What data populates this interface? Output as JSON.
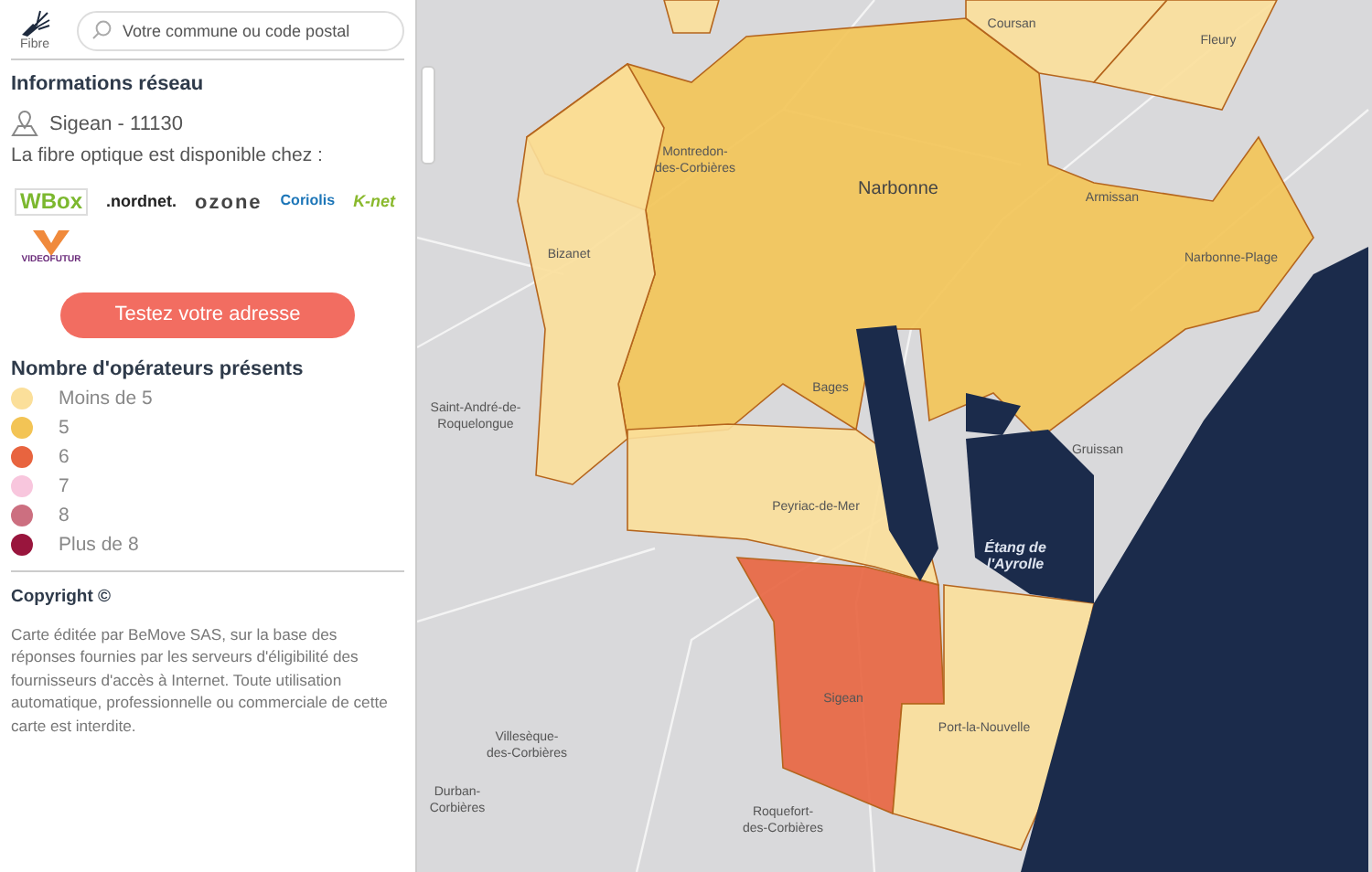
{
  "header": {
    "icon_label": "Fibre",
    "search": {
      "placeholder": "Votre commune ou code postal"
    }
  },
  "network_info": {
    "title": "Informations réseau",
    "location": "Sigean - 11130",
    "availability": "La fibre optique est disponible chez :",
    "providers": [
      {
        "kind": "wibox",
        "name": "WBox"
      },
      {
        "kind": "nordnet",
        "name": ".nordnet."
      },
      {
        "kind": "ozone",
        "name": "ozone"
      },
      {
        "kind": "coriolis",
        "name": "Coriolis"
      },
      {
        "kind": "knet",
        "name": "K-net"
      },
      {
        "kind": "videofutur",
        "name": "VIDEOFUTUR"
      }
    ],
    "test_button": "Testez votre adresse"
  },
  "legend": {
    "title": "Nombre d'opérateurs présents",
    "items": [
      {
        "label": "Moins de 5",
        "color": "#fbdf9a"
      },
      {
        "label": "5",
        "color": "#f3c455"
      },
      {
        "label": "6",
        "color": "#e8643f"
      },
      {
        "label": "7",
        "color": "#f8c6dd"
      },
      {
        "label": "8",
        "color": "#cc6f80"
      },
      {
        "label": "Plus de 8",
        "color": "#99153d"
      }
    ]
  },
  "copyright": {
    "title": "Copyright ©",
    "text": "Carte éditée par BeMove SAS, sur la base des réponses fournies par les serveurs d'éligibilité des fournisseurs d'accès à Internet. Toute utilisation automatique, professionnelle ou commerciale de cette carte est interdite."
  },
  "map": {
    "regions": [
      {
        "kind": "op5"
      },
      {
        "kind": "lt5"
      },
      {
        "kind": "lt5"
      },
      {
        "kind": "lt5"
      },
      {
        "kind": "lt5"
      },
      {
        "kind": "lt5"
      },
      {
        "kind": "op6"
      },
      {
        "kind": "lt5"
      }
    ],
    "labels": [
      {
        "kind": "town",
        "lines": [
          "Coursan"
        ]
      },
      {
        "kind": "town",
        "lines": [
          "Fleury"
        ]
      },
      {
        "kind": "town",
        "lines": [
          "Montredon-",
          "des-Corbières"
        ]
      },
      {
        "kind": "city",
        "lines": [
          "Narbonne"
        ]
      },
      {
        "kind": "town",
        "lines": [
          "Armissan"
        ]
      },
      {
        "kind": "town",
        "lines": [
          "Bizanet"
        ]
      },
      {
        "kind": "town",
        "lines": [
          "Narbonne-Plage"
        ]
      },
      {
        "kind": "town",
        "lines": [
          "Saint-André-de-",
          "Roquelongue"
        ]
      },
      {
        "kind": "town",
        "lines": [
          "Bages"
        ]
      },
      {
        "kind": "town",
        "lines": [
          "Gruissan"
        ]
      },
      {
        "kind": "town",
        "lines": [
          "Peyriac-de-Mer"
        ]
      },
      {
        "kind": "water",
        "lines": [
          "Étang de",
          "l'Ayrolle"
        ]
      },
      {
        "kind": "town",
        "lines": [
          "Sigean"
        ]
      },
      {
        "kind": "town",
        "lines": [
          "Port-la-Nouvelle"
        ]
      },
      {
        "kind": "town",
        "lines": [
          "Villesèque-",
          "des-Corbières"
        ]
      },
      {
        "kind": "town",
        "lines": [
          "Durban-",
          "Corbières"
        ]
      },
      {
        "kind": "town",
        "lines": [
          "Roquefort-",
          "des-Corbières"
        ]
      }
    ]
  }
}
